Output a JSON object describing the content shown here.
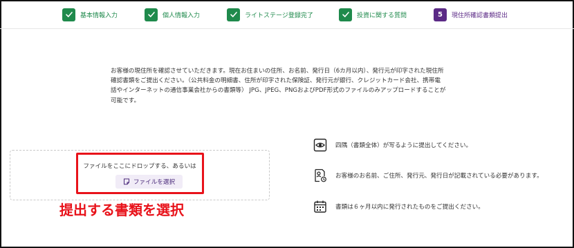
{
  "stepper": {
    "steps": [
      {
        "label": "基本情報入力",
        "status": "done"
      },
      {
        "label": "個人情報入力",
        "status": "done"
      },
      {
        "label": "ライトステージ登録完了",
        "status": "done"
      },
      {
        "label": "投資に関する質問",
        "status": "done"
      },
      {
        "label": "現住所確認書類提出",
        "status": "current",
        "number": "5"
      }
    ]
  },
  "description": {
    "lines": [
      "お客様の現住所を確認させていただきます。現在お住まいの住所、お名前、発行日（6カ月以内）、発行元が印字された現住所",
      "確認書類をご提出ください。（公共料金の明細書、住所が印字された保険証、発行元が銀行、クレジットカード会社、携帯電",
      "話やインターネットの通信事業会社からの書類等） JPG、JPEG、PNGおよびPDF形式のファイルのみアップロードすることが",
      "可能です。"
    ]
  },
  "dropzone": {
    "prompt": "ファイルをここにドロップする、あるいは",
    "button_label": "ファイルを選択"
  },
  "annotation": {
    "text": "提出する書類を選択",
    "color": "#e8121a"
  },
  "requirements": [
    {
      "icon": "eye-icon",
      "text": "四隅（書類全体）が写るように提出してください。"
    },
    {
      "icon": "document-person-icon",
      "text": "お客様のお名前、ご住所、発行元、発行日が記載されている必要があります。"
    },
    {
      "icon": "calendar-icon",
      "text": "書類は６ヶ月以内に発行されたものをご提出ください。"
    }
  ],
  "colors": {
    "done_green": "#1f8a4c",
    "current_purple": "#5b2a86",
    "button_bg": "#f1ecf7"
  }
}
